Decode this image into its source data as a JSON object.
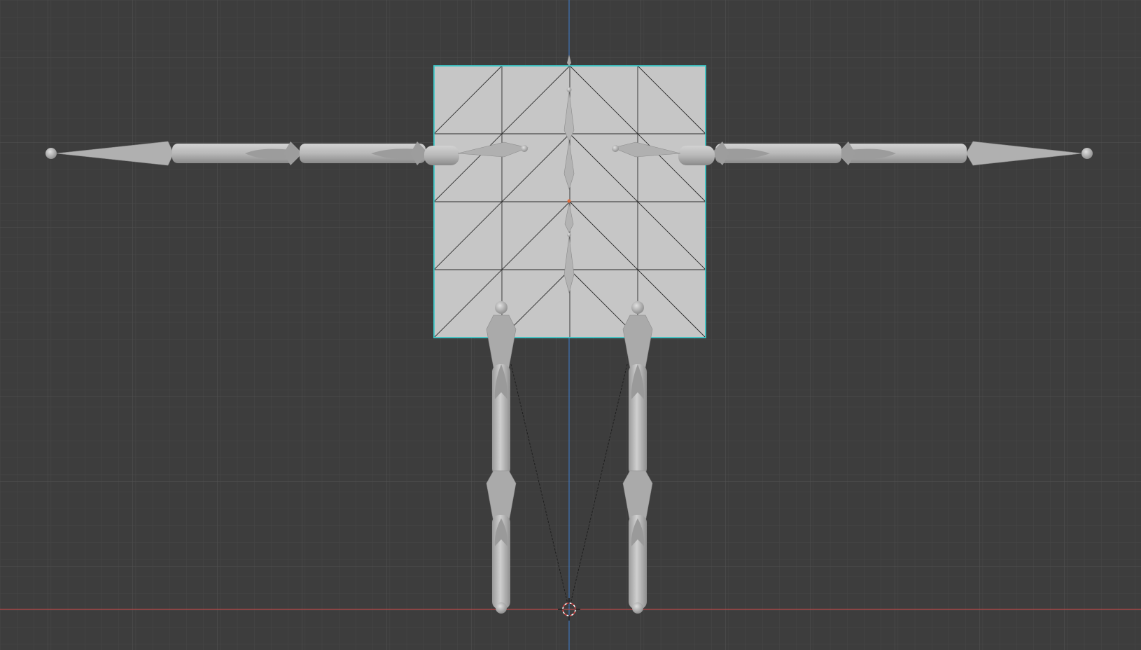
{
  "viewport": {
    "background": "#3d3d3d",
    "grid_minor_color": "#474747",
    "grid_major_color": "#555555",
    "axis_x_color": "#c0504d",
    "axis_z_color": "#4a7fc0",
    "mesh_fill": "#c4c4c4",
    "mesh_outline_color": "#3ec6c6",
    "bone_fill": "#b4b4b4",
    "bone_shadow": "#8e8e8e",
    "origin_color": "#e06b3c",
    "cursor_icon": "3d-cursor-icon"
  }
}
